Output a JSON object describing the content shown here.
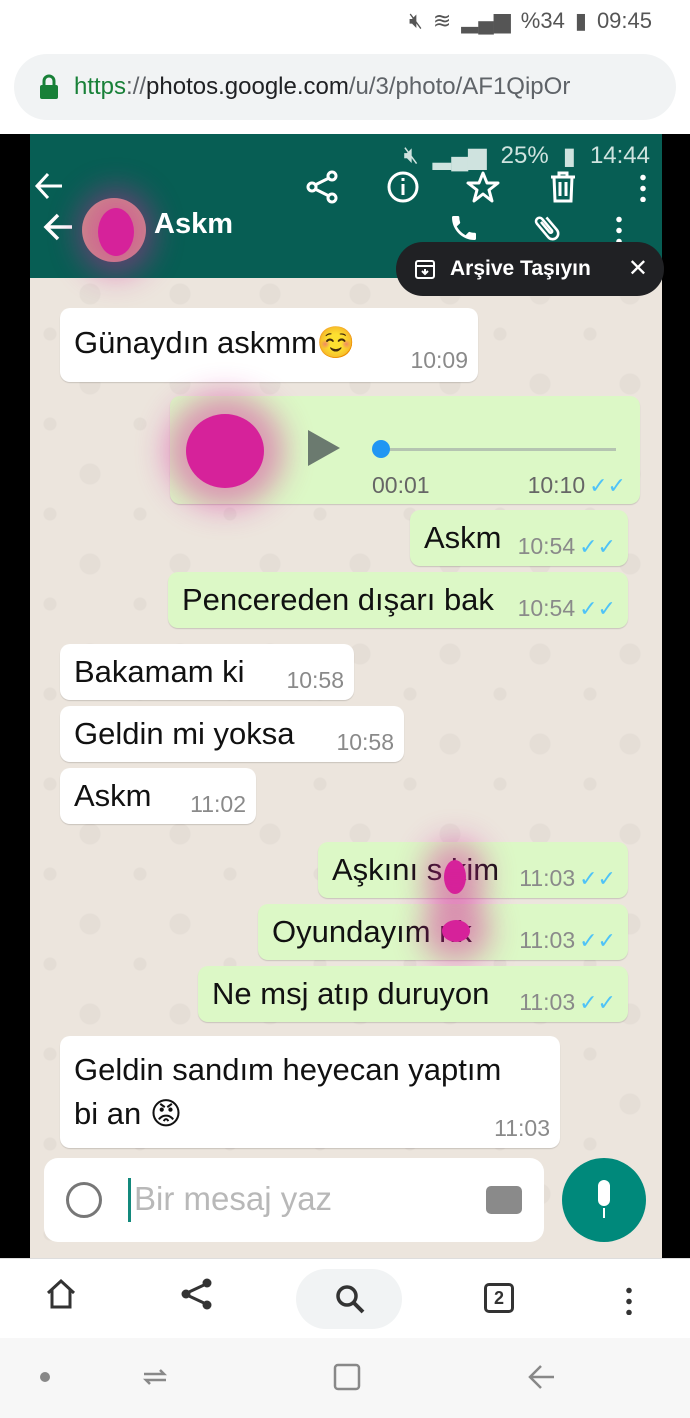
{
  "device_status": {
    "battery": "%34",
    "time": "09:45"
  },
  "browser": {
    "url_scheme": "https",
    "url_sep": "://",
    "url_host": "photos.google.com",
    "url_path": "/u/3/photo/AF1QipOr",
    "tab_count": "2"
  },
  "viewer": {
    "icons": [
      "back-arrow-icon",
      "share-icon",
      "info-icon",
      "star-icon",
      "trash-icon",
      "more-vert-icon"
    ],
    "tooltip": {
      "label": "Arşive Taşıyın",
      "close": "✕"
    }
  },
  "whatsapp": {
    "status": {
      "battery": "25%",
      "time": "14:44"
    },
    "contact_name": "Askm",
    "messages": [
      {
        "dir": "in",
        "text": "Günaydın askmm☺️",
        "time": "10:09"
      },
      {
        "dir": "out",
        "type": "audio",
        "duration": "00:01",
        "time": "10:10",
        "progress": 0.0
      },
      {
        "dir": "out",
        "text": "Askm",
        "time": "10:54"
      },
      {
        "dir": "out",
        "text": "Pencereden dışarı bak",
        "time": "10:54"
      },
      {
        "dir": "in",
        "text": "Bakamam ki",
        "time": "10:58"
      },
      {
        "dir": "in",
        "text": "Geldin mi yoksa",
        "time": "10:58"
      },
      {
        "dir": "in",
        "text": "Askm",
        "time": "11:02"
      },
      {
        "dir": "out",
        "text": "Aşkını s  kim",
        "time": "11:03"
      },
      {
        "dir": "out",
        "text": "Oyundayım    nk",
        "time": "11:03"
      },
      {
        "dir": "out",
        "text": "Ne msj atıp duruyon",
        "time": "11:03"
      },
      {
        "dir": "in",
        "text": "Geldin sandım heyecan yaptım",
        "text2": "bi an 😡",
        "time": "11:03"
      }
    ],
    "composer_placeholder": "Bir mesaj yaz"
  },
  "colors": {
    "wa_green": "#075e54",
    "bubble_out": "#dcf8c6",
    "tick": "#4fc3f7",
    "url_green": "#188038"
  }
}
